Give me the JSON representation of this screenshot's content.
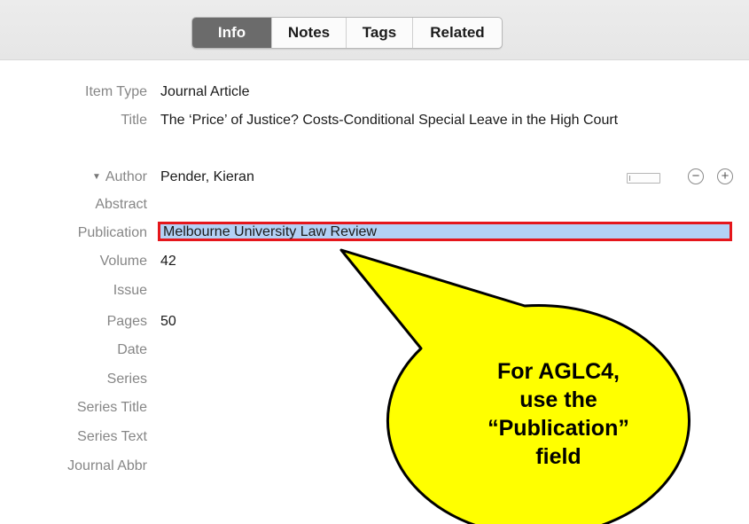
{
  "tabs": [
    {
      "label": "Info",
      "active": true
    },
    {
      "label": "Notes",
      "active": false
    },
    {
      "label": "Tags",
      "active": false
    },
    {
      "label": "Related",
      "active": false
    }
  ],
  "fields": {
    "item_type": {
      "label": "Item Type",
      "value": "Journal Article"
    },
    "title": {
      "label": "Title",
      "value": "The ‘Price’ of Justice? Costs-Conditional Special Leave in the High Court"
    },
    "author": {
      "label": "Author",
      "value": "Pender, Kieran",
      "expander_icon": "triangle-down-icon"
    },
    "abstract": {
      "label": "Abstract",
      "value": ""
    },
    "publication": {
      "label": "Publication",
      "value": "Melbourne University Law Review"
    },
    "volume": {
      "label": "Volume",
      "value": "42"
    },
    "issue": {
      "label": "Issue",
      "value": ""
    },
    "pages": {
      "label": "Pages",
      "value": "50"
    },
    "date": {
      "label": "Date",
      "value": ""
    },
    "series": {
      "label": "Series",
      "value": ""
    },
    "series_title": {
      "label": "Series Title",
      "value": ""
    },
    "series_text": {
      "label": "Series Text",
      "value": ""
    },
    "journal_abbr": {
      "label": "Journal Abbr",
      "value": ""
    }
  },
  "author_controls": {
    "remove_icon": "minus-circle-icon",
    "add_icon": "plus-circle-icon"
  },
  "callout": {
    "line1": "For AGLC4,",
    "line2": "use the",
    "line3": "“Publication”",
    "line4": "field"
  },
  "colors": {
    "highlight": "#b3d1f5",
    "outline": "#e5161b",
    "callout_fill": "#ffff00",
    "active_tab": "#6b6b6b"
  }
}
